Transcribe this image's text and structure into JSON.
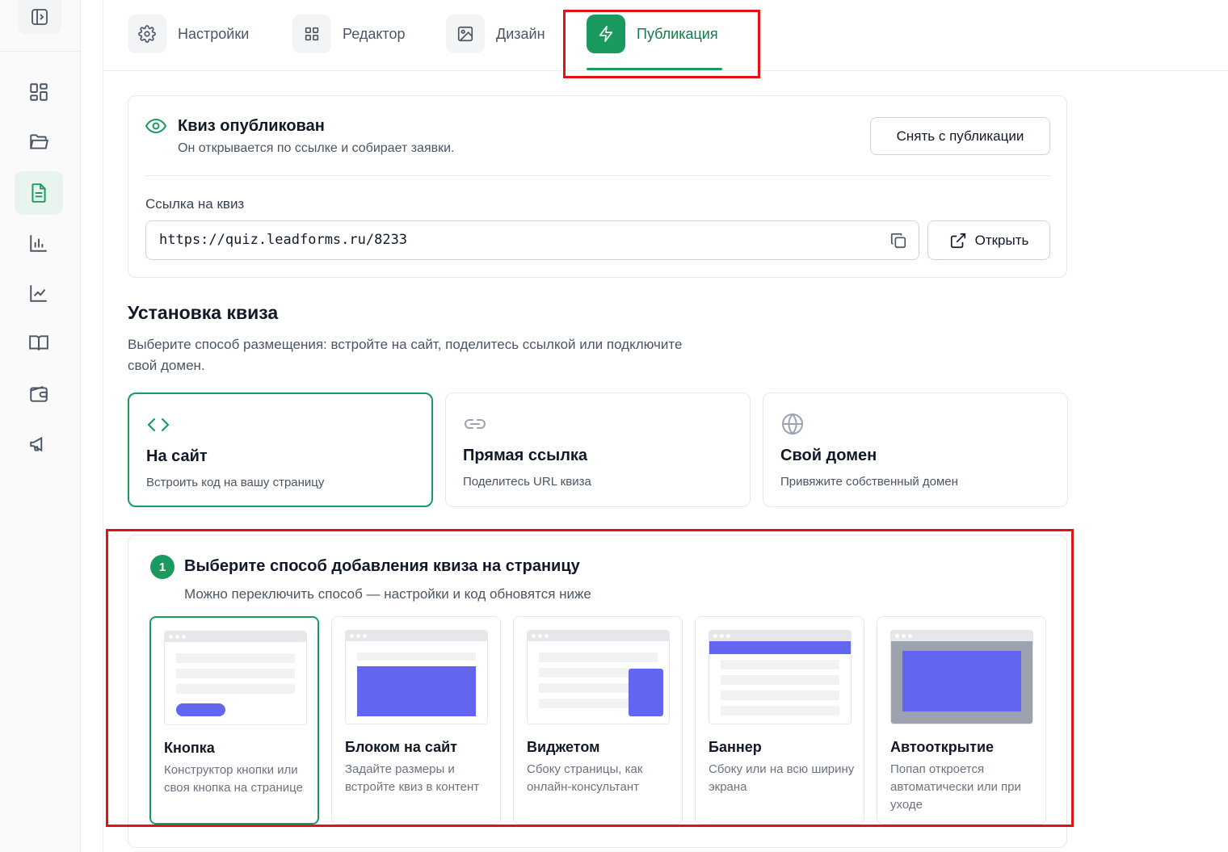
{
  "sidebar": {
    "icons": [
      "sidebar-toggle-icon",
      "dashboard-icon",
      "folder-icon",
      "document-icon",
      "bar-chart-icon",
      "line-chart-icon",
      "book-icon",
      "wallet-icon",
      "megaphone-icon"
    ],
    "active": "document-icon"
  },
  "tabs": [
    {
      "label": "Настройки",
      "icon": "gear-icon"
    },
    {
      "label": "Редактор",
      "icon": "grid-icon"
    },
    {
      "label": "Дизайн",
      "icon": "image-icon"
    },
    {
      "label": "Публикация",
      "icon": "lightning-icon",
      "active": true
    }
  ],
  "published": {
    "title": "Квиз опубликован",
    "subtitle": "Он открывается по ссылке и собирает заявки.",
    "unpublish_label": "Снять с публикации",
    "link_label": "Ссылка на квиз",
    "link_value": "https://quiz.leadforms.ru/8233",
    "open_label": "Открыть"
  },
  "install": {
    "title": "Установка квиза",
    "description": "Выберите способ размещения: встройте на сайт, поделитесь ссылкой или подключите свой домен.",
    "options": [
      {
        "title": "На сайт",
        "desc": "Встроить код на вашу страницу",
        "icon": "code-icon",
        "selected": true
      },
      {
        "title": "Прямая ссылка",
        "desc": "Поделитесь URL квиза",
        "icon": "link-icon"
      },
      {
        "title": "Свой домен",
        "desc": "Привяжите собственный домен",
        "icon": "globe-icon"
      }
    ]
  },
  "step": {
    "number": "1",
    "title": "Выберите способ добавления квиза на страницу",
    "subtitle": "Можно переключить способ — настройки и код обновятся ниже",
    "modes": [
      {
        "title": "Кнопка",
        "desc": "Конструктор кнопки или своя кнопка на странице",
        "selected": true
      },
      {
        "title": "Блоком на сайт",
        "desc": "Задайте размеры и встройте квиз в контент"
      },
      {
        "title": "Виджетом",
        "desc": "Сбоку страницы, как онлайн-консультант"
      },
      {
        "title": "Баннер",
        "desc": "Сбоку или на всю ширину экрана"
      },
      {
        "title": "Автооткрытие",
        "desc": "Попап откроется автоматически или при уходе"
      }
    ]
  },
  "colors": {
    "accent": "#1a9a5e",
    "preview_accent": "#6366f1",
    "highlight": "#e01414"
  }
}
